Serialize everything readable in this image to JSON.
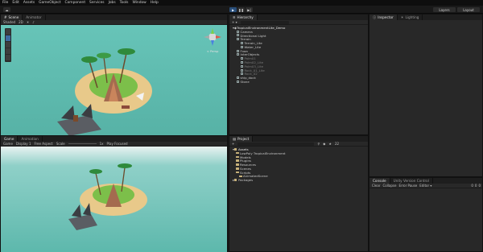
{
  "menu": [
    "File",
    "Edit",
    "Assets",
    "GameObject",
    "Component",
    "Services",
    "Jobs",
    "Tools",
    "Window",
    "Help"
  ],
  "toolbar": {
    "play": "▶",
    "pause": "❚❚",
    "step": "▶|",
    "layers": "Layers",
    "layout": "Layout"
  },
  "scene_tabs": [
    "Scene",
    "Animator"
  ],
  "scene_bar": {
    "shading": "Shaded",
    "mode": "2D",
    "persp": "< Persp"
  },
  "game_tabs": [
    "Game",
    "Animation"
  ],
  "game_bar": {
    "game": "Game",
    "display": "Display 1",
    "aspect": "Free Aspect",
    "scale_label": "Scale",
    "scale_value": "1x",
    "play_mode": "Play Focused"
  },
  "hierarchy": {
    "tab": "Hierarchy",
    "root": "TropicalEnvironmentLite_Demo",
    "items": [
      {
        "label": "Camera",
        "indent": 1,
        "dim": false
      },
      {
        "label": "Directional Light",
        "indent": 1,
        "dim": false
      },
      {
        "label": "Terrain",
        "indent": 1,
        "dim": false
      },
      {
        "label": "Terrain_Lite",
        "indent": 2,
        "dim": false
      },
      {
        "label": "Water_Lite",
        "indent": 2,
        "dim": false
      },
      {
        "label": "Fxaa",
        "indent": 1,
        "dim": false
      },
      {
        "label": "InterObjects",
        "indent": 1,
        "dim": false
      },
      {
        "label": "Palm01",
        "indent": 2,
        "dim": true
      },
      {
        "label": "Palm02_Lite",
        "indent": 2,
        "dim": true
      },
      {
        "label": "Palm03_Lite",
        "indent": 2,
        "dim": true
      },
      {
        "label": "Rock_01_Lite",
        "indent": 2,
        "dim": true
      },
      {
        "label": "Rock_02",
        "indent": 2,
        "dim": true
      },
      {
        "label": "ship_dock",
        "indent": 1,
        "dim": false
      },
      {
        "label": "Stone",
        "indent": 1,
        "dim": false
      }
    ]
  },
  "inspector_tabs": [
    "Inspector",
    "Lighting"
  ],
  "project": {
    "tab": "Project",
    "add": "+",
    "assets_label": "Assets",
    "folders": [
      {
        "label": "LowPoly TropicalEnvironment",
        "indent": 1
      },
      {
        "label": "Models",
        "indent": 1
      },
      {
        "label": "Plugins",
        "indent": 1
      },
      {
        "label": "Resources",
        "indent": 1
      },
      {
        "label": "Scenes",
        "indent": 1
      },
      {
        "label": "Scripts",
        "indent": 1
      },
      {
        "label": "AnimatedScene",
        "indent": 2
      }
    ],
    "packages_label": "Packages",
    "count": "22"
  },
  "console": {
    "tabs": [
      "Console",
      "Unity Version Control"
    ],
    "buttons": [
      "Clear",
      "Collapse",
      "Error Pause",
      "Editor ▾"
    ],
    "counts": [
      "0",
      "0",
      "0"
    ]
  },
  "colors": {
    "play_active": "#2a4f7a",
    "sea": "#5bb7ab",
    "sand": "#e8c98a",
    "grass": "#7cbf4a"
  }
}
